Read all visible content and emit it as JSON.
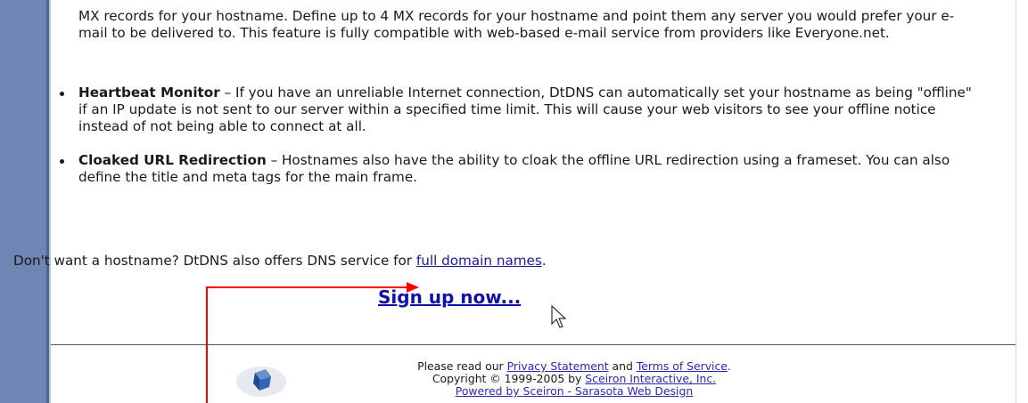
{
  "features": {
    "mx_paragraph": "MX records for your hostname. Define up to 4 MX records for your hostname and point them any server you would prefer your e-mail to be delivered to. This feature is fully compatible with web-based e-mail service from providers like Everyone.net.",
    "items": [
      {
        "title": "Heartbeat Monitor",
        "description": " – If you have an unreliable Internet connection, DtDNS can automatically set your hostname as being \"offline\" if an IP update is not sent to our server within a specified time limit. This will cause your web visitors to see your offline notice instead of not being able to connect at all."
      },
      {
        "title": "Cloaked URL Redirection",
        "description": " – Hostnames also have the ability to cloak the offline URL redirection using a frameset. You can also define the title and meta tags for the main frame."
      }
    ]
  },
  "domain_offer": {
    "text": "Don't want a hostname? DtDNS also offers DNS service for ",
    "link": "full domain names",
    "suffix": "."
  },
  "signup": {
    "label": "Sign up now..."
  },
  "footer": {
    "line1_prefix": "Please read our ",
    "privacy_link": "Privacy Statement",
    "line1_mid": " and ",
    "terms_link": "Terms of Service",
    "line1_suffix": ".",
    "line2_prefix": "Copyright © 1999-2005 by ",
    "company_link": "Sceiron Interactive, Inc.",
    "powered_link": "Powered by Sceiron - Sarasota Web Design"
  },
  "colors": {
    "left_bar": "#6e86b3",
    "link": "#1a1a9a",
    "annotation_arrow": "#ff0000"
  },
  "icons": {
    "logo": "cube-logo-icon",
    "cursor": "mouse-pointer-icon"
  }
}
